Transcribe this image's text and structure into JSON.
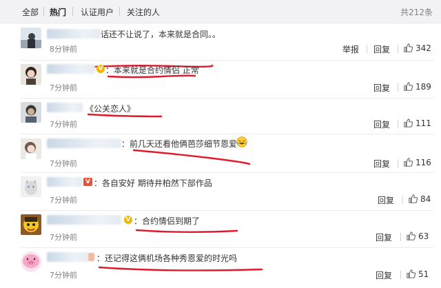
{
  "tabs": [
    {
      "label": "全部",
      "active": false
    },
    {
      "label": "热门",
      "active": true
    },
    {
      "label": "认证用户",
      "active": false
    },
    {
      "label": "关注的人",
      "active": false
    }
  ],
  "total": "共212条",
  "actions": {
    "report": "举报",
    "reply": "回复"
  },
  "comments": [
    {
      "text": "话还不让说了，本来就是合同。。",
      "time": "8分钟前",
      "likes": "342",
      "show_report": true,
      "badge": "none"
    },
    {
      "text": "：本来就是合约情侣 正常",
      "time": "7分钟前",
      "likes": "189",
      "show_report": false,
      "badge": "v-yellow"
    },
    {
      "text": "《公关恋人》",
      "time": "7分钟前",
      "likes": "111",
      "show_report": false,
      "badge": "none"
    },
    {
      "text": "：前几天还看他俩芭莎细节恩爱",
      "time": "7分钟前",
      "likes": "116",
      "show_report": false,
      "badge": "none",
      "emoji": "laughing-emoji"
    },
    {
      "text": "：各自安好 期待井柏然下部作品",
      "time": "7分钟前",
      "likes": "84",
      "show_report": false,
      "badge": "v-red"
    },
    {
      "text": "：合约情侣到期了",
      "time": "7分钟前",
      "likes": "63",
      "show_report": false,
      "badge": "v-yellow"
    },
    {
      "text": "：还记得这俩机场各种秀恩爱的时光吗",
      "time": "7分钟前",
      "likes": "51",
      "show_report": false,
      "badge": "none"
    }
  ],
  "colors": {
    "underline": "#e0192d",
    "tabbar_bg": "#f2f2f5",
    "muted": "#808080",
    "verified_yellow": "#f4b400"
  }
}
